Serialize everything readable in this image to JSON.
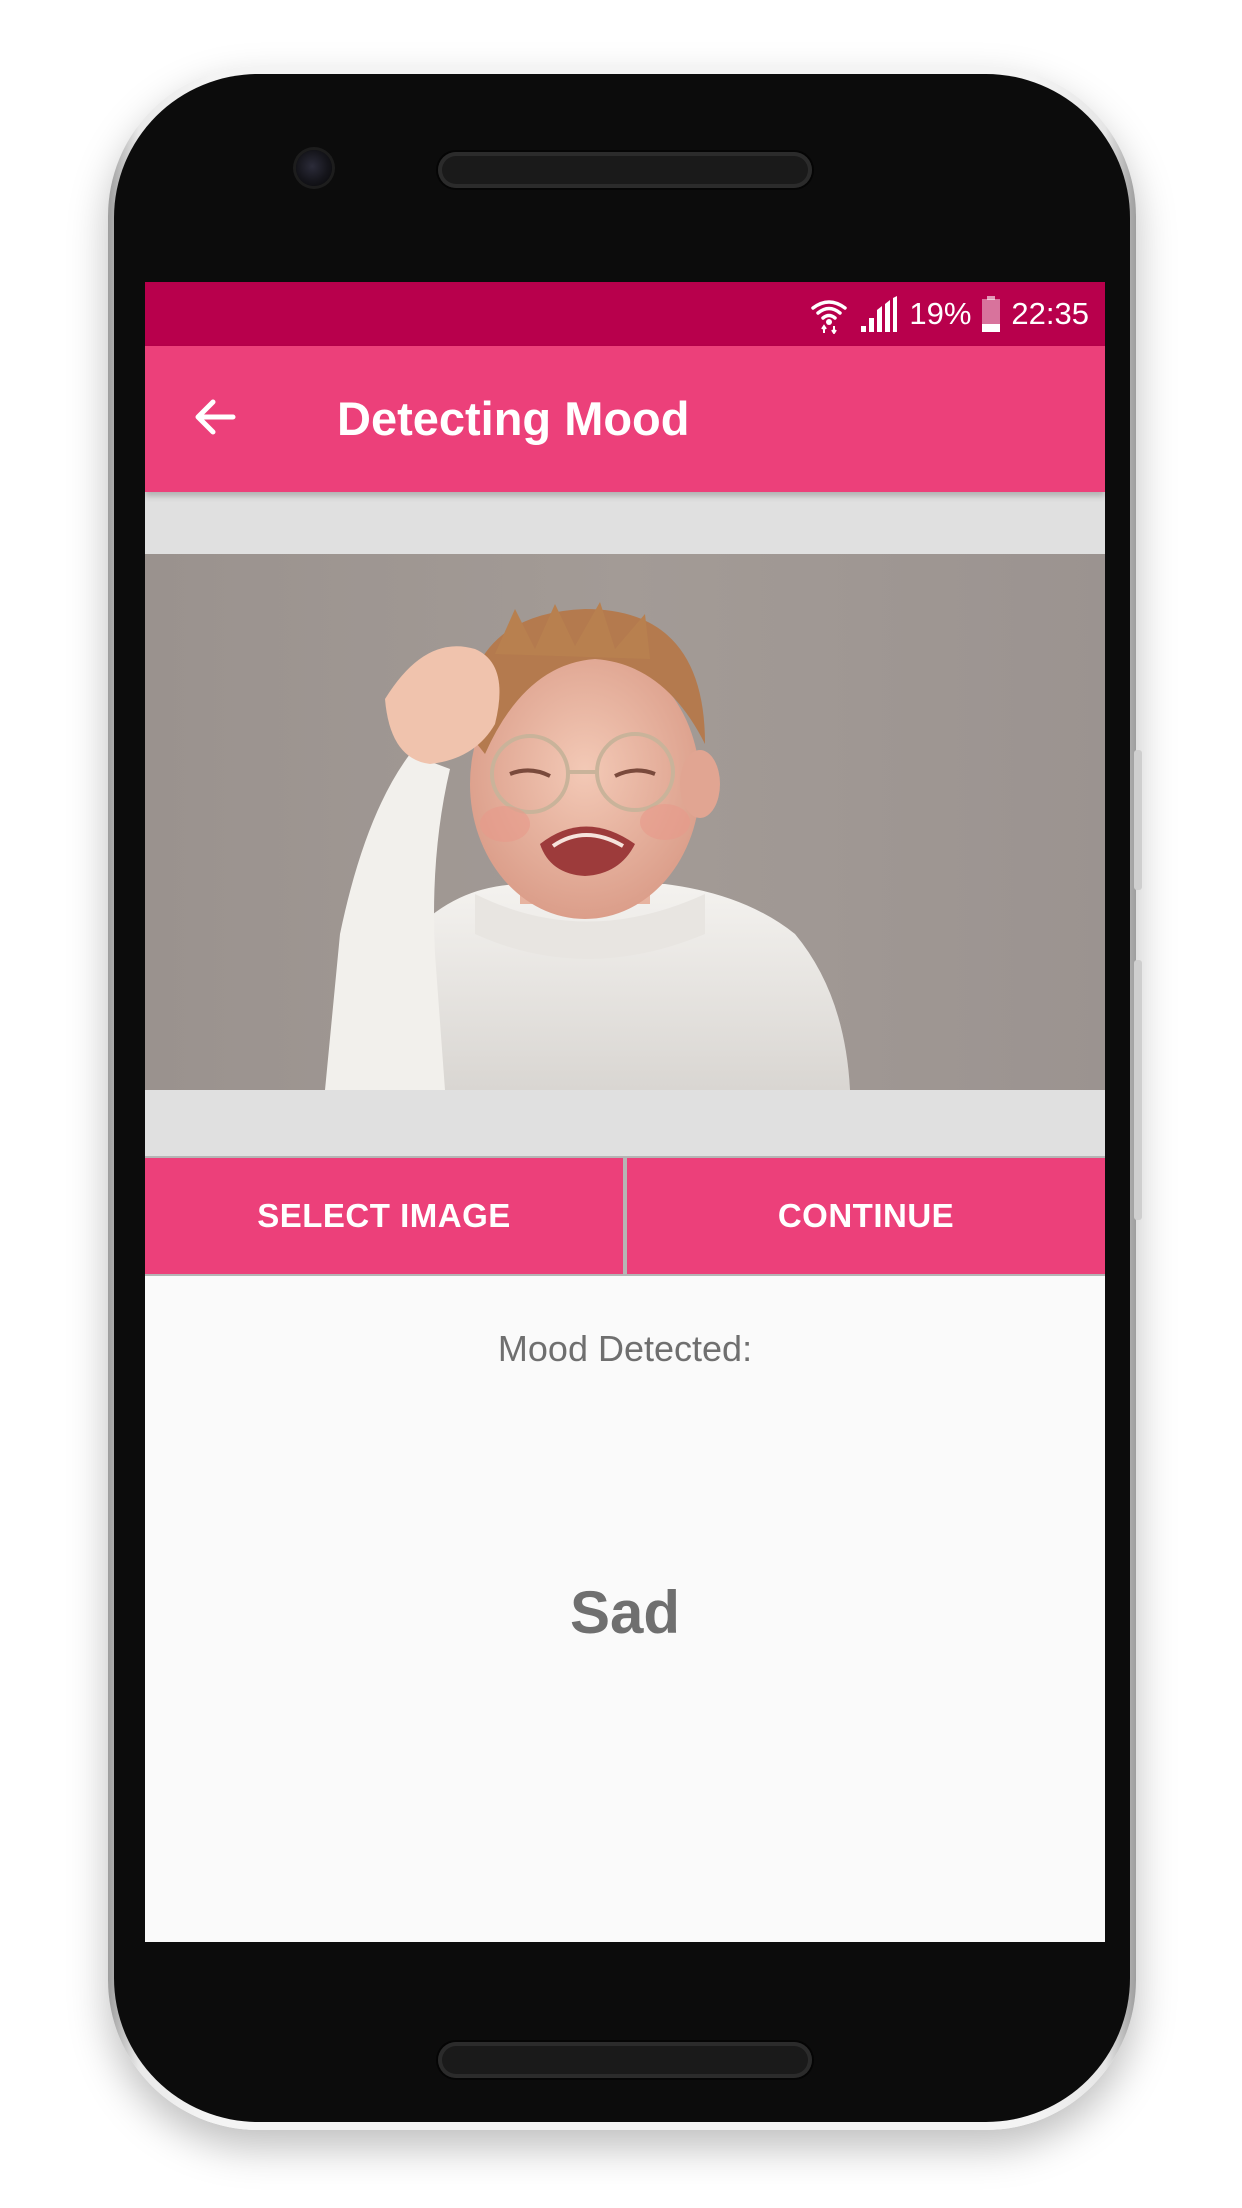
{
  "status_bar": {
    "battery_percent": "19%",
    "time": "22:35",
    "icons": [
      "wifi-icon",
      "signal-icon",
      "battery-icon"
    ],
    "color": "#b8004c"
  },
  "app_bar": {
    "title": "Detecting Mood",
    "back_icon": "arrow-left-icon",
    "color": "#ec407a"
  },
  "image": {
    "subject": "crying-child-photo"
  },
  "actions": {
    "select_image_label": "SELECT IMAGE",
    "continue_label": "CONTINUE"
  },
  "result": {
    "label": "Mood Detected:",
    "mood": "Sad"
  }
}
